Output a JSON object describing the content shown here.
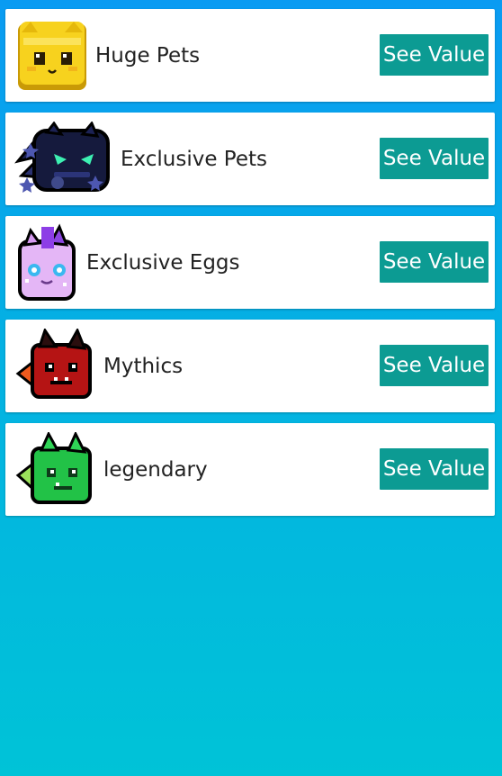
{
  "colors": {
    "button": "#0c9b93",
    "card": "#ffffff",
    "background_top": "#0a9bf2",
    "background_bottom": "#00c3d7"
  },
  "categories": [
    {
      "label": "Huge Pets",
      "icon": "huge-cat-pet-icon",
      "button_label": "See Value"
    },
    {
      "label": "Exclusive Pets",
      "icon": "dark-dragon-pet-icon",
      "button_label": "See Value"
    },
    {
      "label": "Exclusive Eggs",
      "icon": "unicorn-egg-pet-icon",
      "button_label": "See Value"
    },
    {
      "label": "Mythics",
      "icon": "red-demon-pet-icon",
      "button_label": "See Value"
    },
    {
      "label": "legendary",
      "icon": "green-dragon-pet-icon",
      "button_label": "See Value"
    }
  ]
}
